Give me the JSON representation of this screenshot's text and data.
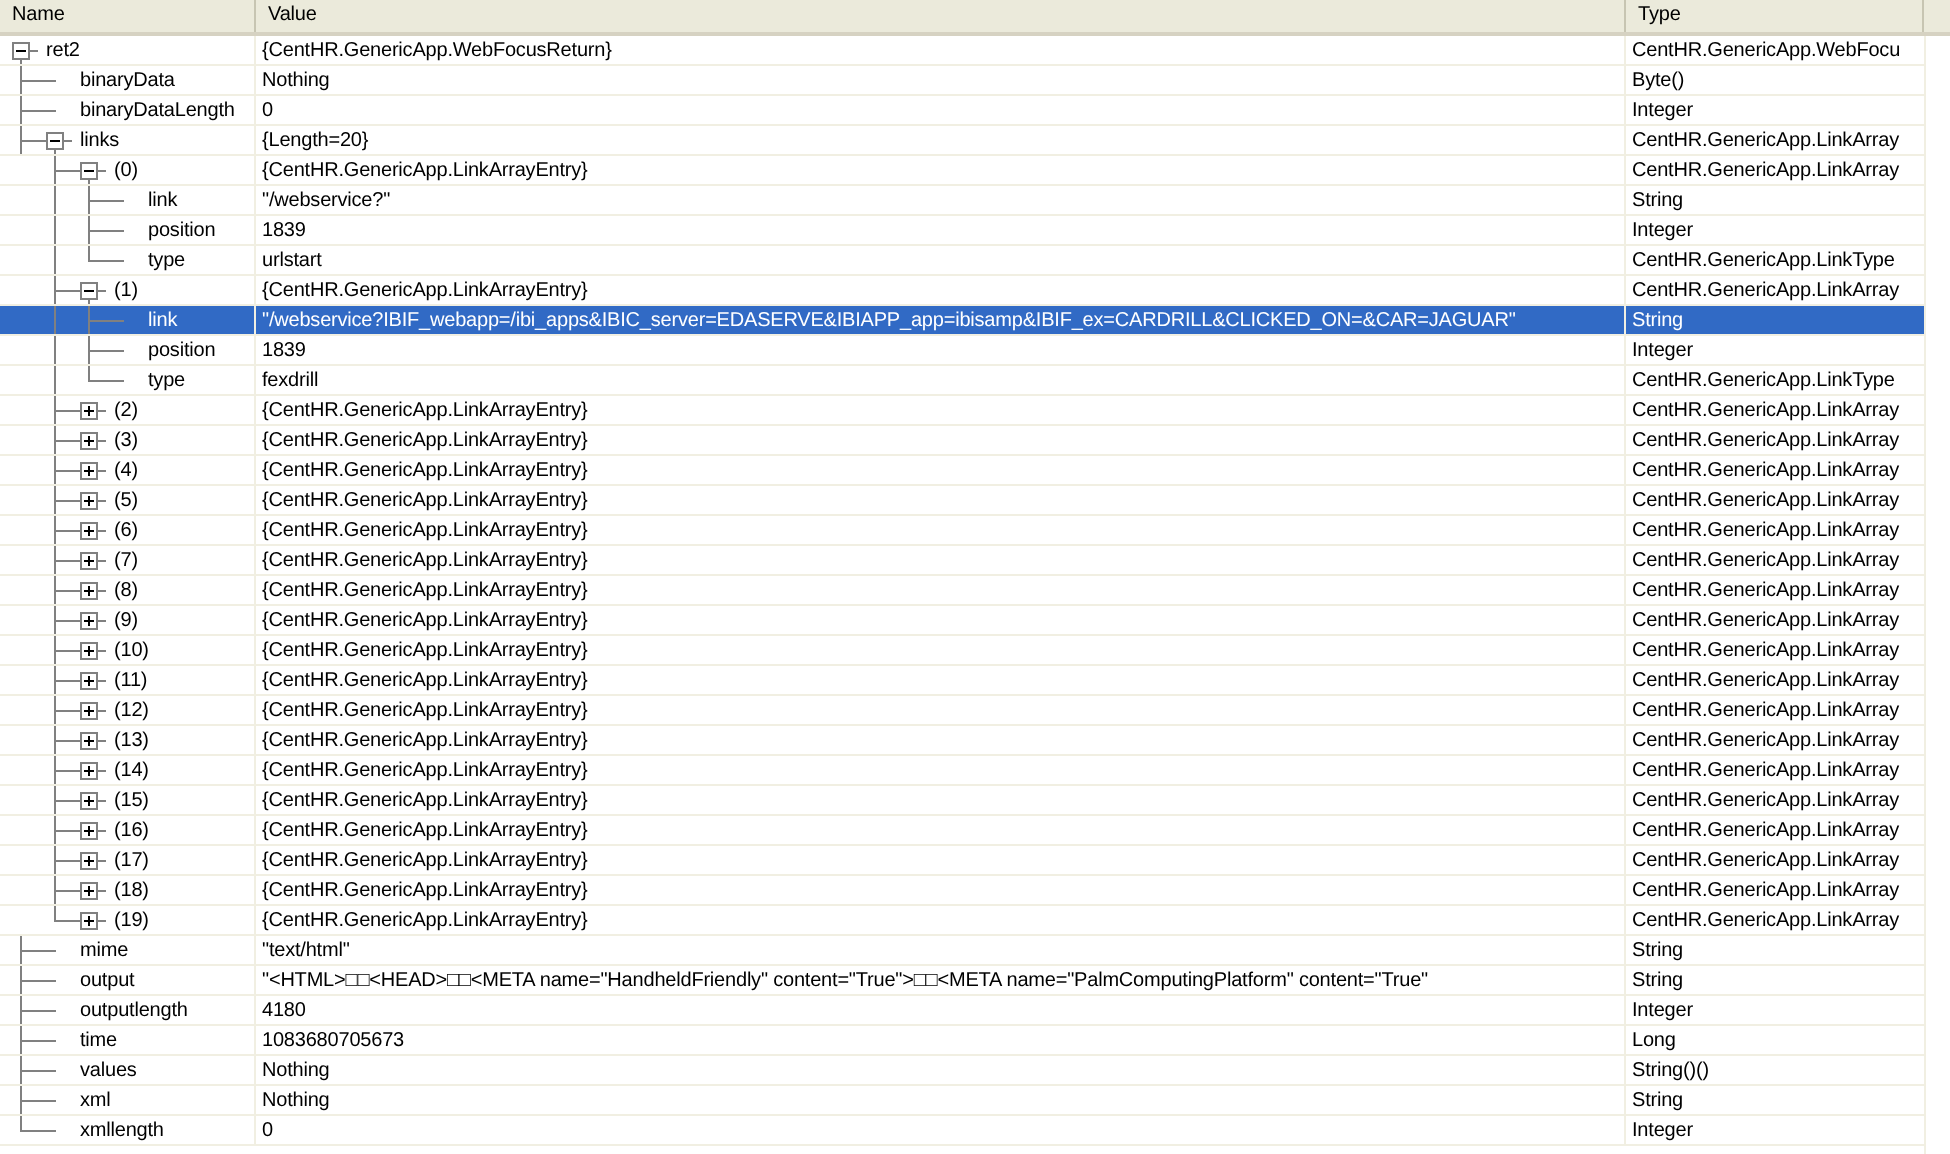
{
  "columns": [
    "Name",
    "Value",
    "Type"
  ],
  "tree": [
    {
      "name": "ret2",
      "value": "{CentHR.GenericApp.WebFocusReturn}",
      "type": "CentHR.GenericApp.WebFocu",
      "expanded": true,
      "selected": false,
      "children": [
        {
          "name": "binaryData",
          "value": "Nothing",
          "type": "Byte()",
          "selected": false
        },
        {
          "name": "binaryDataLength",
          "value": "0",
          "type": "Integer",
          "selected": false
        },
        {
          "name": "links",
          "value": "{Length=20}",
          "type": "CentHR.GenericApp.LinkArray",
          "expanded": true,
          "selected": false,
          "children": [
            {
              "name": "(0)",
              "value": "{CentHR.GenericApp.LinkArrayEntry}",
              "type": "CentHR.GenericApp.LinkArray",
              "expanded": true,
              "selected": false,
              "children": [
                {
                  "name": "link",
                  "value": "\"/webservice?\"",
                  "type": "String",
                  "selected": false
                },
                {
                  "name": "position",
                  "value": "1839",
                  "type": "Integer",
                  "selected": false
                },
                {
                  "name": "type",
                  "value": "urlstart",
                  "type": "CentHR.GenericApp.LinkType",
                  "selected": false
                }
              ]
            },
            {
              "name": "(1)",
              "value": "{CentHR.GenericApp.LinkArrayEntry}",
              "type": "CentHR.GenericApp.LinkArray",
              "expanded": true,
              "selected": false,
              "children": [
                {
                  "name": "link",
                  "value": "\"/webservice?IBIF_webapp=/ibi_apps&IBIC_server=EDASERVE&IBIAPP_app=ibisamp&IBIF_ex=CARDRILL&CLICKED_ON=&CAR=JAGUAR\"",
                  "type": "String",
                  "selected": true
                },
                {
                  "name": "position",
                  "value": "1839",
                  "type": "Integer",
                  "selected": false
                },
                {
                  "name": "type",
                  "value": "fexdrill",
                  "type": "CentHR.GenericApp.LinkType",
                  "selected": false
                }
              ]
            },
            {
              "name": "(2)",
              "value": "{CentHR.GenericApp.LinkArrayEntry}",
              "type": "CentHR.GenericApp.LinkArray",
              "expanded": false,
              "selected": false
            },
            {
              "name": "(3)",
              "value": "{CentHR.GenericApp.LinkArrayEntry}",
              "type": "CentHR.GenericApp.LinkArray",
              "expanded": false,
              "selected": false
            },
            {
              "name": "(4)",
              "value": "{CentHR.GenericApp.LinkArrayEntry}",
              "type": "CentHR.GenericApp.LinkArray",
              "expanded": false,
              "selected": false
            },
            {
              "name": "(5)",
              "value": "{CentHR.GenericApp.LinkArrayEntry}",
              "type": "CentHR.GenericApp.LinkArray",
              "expanded": false,
              "selected": false
            },
            {
              "name": "(6)",
              "value": "{CentHR.GenericApp.LinkArrayEntry}",
              "type": "CentHR.GenericApp.LinkArray",
              "expanded": false,
              "selected": false
            },
            {
              "name": "(7)",
              "value": "{CentHR.GenericApp.LinkArrayEntry}",
              "type": "CentHR.GenericApp.LinkArray",
              "expanded": false,
              "selected": false
            },
            {
              "name": "(8)",
              "value": "{CentHR.GenericApp.LinkArrayEntry}",
              "type": "CentHR.GenericApp.LinkArray",
              "expanded": false,
              "selected": false
            },
            {
              "name": "(9)",
              "value": "{CentHR.GenericApp.LinkArrayEntry}",
              "type": "CentHR.GenericApp.LinkArray",
              "expanded": false,
              "selected": false
            },
            {
              "name": "(10)",
              "value": "{CentHR.GenericApp.LinkArrayEntry}",
              "type": "CentHR.GenericApp.LinkArray",
              "expanded": false,
              "selected": false
            },
            {
              "name": "(11)",
              "value": "{CentHR.GenericApp.LinkArrayEntry}",
              "type": "CentHR.GenericApp.LinkArray",
              "expanded": false,
              "selected": false
            },
            {
              "name": "(12)",
              "value": "{CentHR.GenericApp.LinkArrayEntry}",
              "type": "CentHR.GenericApp.LinkArray",
              "expanded": false,
              "selected": false
            },
            {
              "name": "(13)",
              "value": "{CentHR.GenericApp.LinkArrayEntry}",
              "type": "CentHR.GenericApp.LinkArray",
              "expanded": false,
              "selected": false
            },
            {
              "name": "(14)",
              "value": "{CentHR.GenericApp.LinkArrayEntry}",
              "type": "CentHR.GenericApp.LinkArray",
              "expanded": false,
              "selected": false
            },
            {
              "name": "(15)",
              "value": "{CentHR.GenericApp.LinkArrayEntry}",
              "type": "CentHR.GenericApp.LinkArray",
              "expanded": false,
              "selected": false
            },
            {
              "name": "(16)",
              "value": "{CentHR.GenericApp.LinkArrayEntry}",
              "type": "CentHR.GenericApp.LinkArray",
              "expanded": false,
              "selected": false
            },
            {
              "name": "(17)",
              "value": "{CentHR.GenericApp.LinkArrayEntry}",
              "type": "CentHR.GenericApp.LinkArray",
              "expanded": false,
              "selected": false
            },
            {
              "name": "(18)",
              "value": "{CentHR.GenericApp.LinkArrayEntry}",
              "type": "CentHR.GenericApp.LinkArray",
              "expanded": false,
              "selected": false
            },
            {
              "name": "(19)",
              "value": "{CentHR.GenericApp.LinkArrayEntry}",
              "type": "CentHR.GenericApp.LinkArray",
              "expanded": false,
              "selected": false
            }
          ]
        },
        {
          "name": "mime",
          "value": "\"text/html\"",
          "type": "String",
          "selected": false
        },
        {
          "name": "output",
          "value": "\"<HTML>□□<HEAD>□□<META name=\"HandheldFriendly\" content=\"True\">□□<META name=\"PalmComputingPlatform\" content=\"True\"",
          "type": "String",
          "selected": false
        },
        {
          "name": "outputlength",
          "value": "4180",
          "type": "Integer",
          "selected": false
        },
        {
          "name": "time",
          "value": "1083680705673",
          "type": "Long",
          "selected": false
        },
        {
          "name": "values",
          "value": "Nothing",
          "type": "String()()",
          "selected": false
        },
        {
          "name": "xml",
          "value": "Nothing",
          "type": "String",
          "selected": false
        },
        {
          "name": "xmllength",
          "value": "0",
          "type": "Integer",
          "selected": false
        }
      ]
    }
  ]
}
